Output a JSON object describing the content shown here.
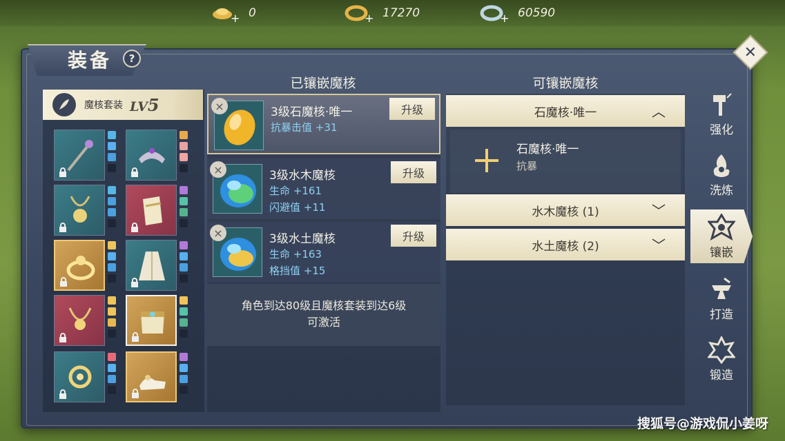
{
  "currencies": [
    {
      "icon": "gold-ingot-icon",
      "value": "0"
    },
    {
      "icon": "gold-ring-icon",
      "value": "17270"
    },
    {
      "icon": "silver-ring-icon",
      "value": "60590"
    }
  ],
  "window": {
    "title": "装备",
    "help": "?",
    "close": "✕"
  },
  "set": {
    "label": "魔核套装",
    "lv_prefix": "LV",
    "lv_value": "5"
  },
  "equipment": [
    {
      "icon": "staff-icon",
      "color": "teal"
    },
    {
      "icon": "crown-icon",
      "color": "teal"
    },
    {
      "icon": "amulet-icon",
      "color": "teal"
    },
    {
      "icon": "bracer-icon",
      "color": "red"
    },
    {
      "icon": "ring-icon",
      "color": "gold"
    },
    {
      "icon": "robe-icon",
      "color": "teal"
    },
    {
      "icon": "necklace-icon",
      "color": "red"
    },
    {
      "icon": "belt-icon",
      "color": "gold-selected"
    },
    {
      "icon": "pendant-icon",
      "color": "teal"
    },
    {
      "icon": "shoes-icon",
      "color": "gold"
    }
  ],
  "embedded": {
    "title": "已镶嵌魔核",
    "upgrade_label": "升级",
    "remove_label": "×",
    "cores": [
      {
        "name": "3级石魔核·唯一",
        "stat1": "抗暴击值 +31",
        "stat2": "",
        "orb": "gold"
      },
      {
        "name": "3级水木魔核",
        "stat1": "生命 +161",
        "stat2": "闪避值 +11",
        "orb": "green-blue"
      },
      {
        "name": "3级水土魔核",
        "stat1": "生命 +163",
        "stat2": "格挡值 +15",
        "orb": "blue-yellow"
      }
    ],
    "note_line1": "角色到达80级且魔核套装到达6级",
    "note_line2": "可激活"
  },
  "available": {
    "title": "可镶嵌魔核",
    "categories": [
      {
        "label": "石魔核·唯一",
        "chevron": "^"
      },
      {
        "label": "水木魔核 (1)",
        "chevron": "v"
      },
      {
        "label": "水土魔核 (2)",
        "chevron": "v"
      }
    ],
    "item": {
      "name": "石魔核·唯一",
      "desc": "抗暴"
    }
  },
  "tabs": [
    {
      "label": "强化",
      "icon": "hammer-icon"
    },
    {
      "label": "洗炼",
      "icon": "flame-icon"
    },
    {
      "label": "镶嵌",
      "icon": "gem-inlay-icon",
      "active": true
    },
    {
      "label": "打造",
      "icon": "anvil-icon"
    },
    {
      "label": "锻造",
      "icon": "forge-icon"
    }
  ],
  "watermark": "搜狐号@游戏侃小姜呀"
}
